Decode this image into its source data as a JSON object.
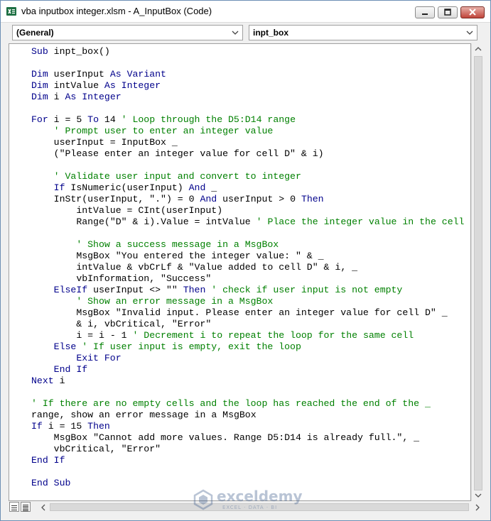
{
  "window": {
    "title": "vba inputbox integer.xlsm - A_InputBox (Code)",
    "minimize_icon": "minimize-icon",
    "restore_icon": "restore-icon",
    "close_icon": "close-icon"
  },
  "object_combo": {
    "value": "(General)"
  },
  "procedure_combo": {
    "value": "inpt_box"
  },
  "colors": {
    "keyword": "#00008b",
    "comment": "#008000",
    "text": "#000000"
  },
  "code_lines": [
    "Sub inpt_box()",
    "",
    "Dim userInput As Variant",
    "Dim intValue As Integer",
    "Dim i As Integer",
    "",
    "For i = 5 To 14 ' Loop through the D5:D14 range",
    "    ' Prompt user to enter an integer value",
    "    userInput = InputBox _",
    "    (\"Please enter an integer value for cell D\" & i)",
    "",
    "    ' Validate user input and convert to integer",
    "    If IsNumeric(userInput) And _",
    "    InStr(userInput, \".\") = 0 And userInput > 0 Then",
    "        intValue = CInt(userInput)",
    "        Range(\"D\" & i).Value = intValue ' Place the integer value in the cell",
    "",
    "        ' Show a success message in a MsgBox",
    "        MsgBox \"You entered the integer value: \" & _",
    "        intValue & vbCrLf & \"Value added to cell D\" & i, _",
    "        vbInformation, \"Success\"",
    "    ElseIf userInput <> \"\" Then ' check if user input is not empty",
    "        ' Show an error message in a MsgBox",
    "        MsgBox \"Invalid input. Please enter an integer value for cell D\" _",
    "        & i, vbCritical, \"Error\"",
    "        i = i - 1 ' Decrement i to repeat the loop for the same cell",
    "    Else ' If user input is empty, exit the loop",
    "        Exit For",
    "    End If",
    "Next i",
    "",
    "' If there are no empty cells and the loop has reached the end of the _",
    "range, show an error message in a MsgBox",
    "If i = 15 Then",
    "    MsgBox \"Cannot add more values. Range D5:D14 is already full.\", _",
    "    vbCritical, \"Error\"",
    "End If",
    "",
    "End Sub"
  ],
  "keywords": [
    "Sub",
    "Dim",
    "As",
    "Variant",
    "Integer",
    "For",
    "To",
    "If",
    "And",
    "Then",
    "ElseIf",
    "Else",
    "Exit",
    "End",
    "Next"
  ],
  "watermark": {
    "name": "exceldemy",
    "tagline": "EXCEL · DATA · BI"
  }
}
